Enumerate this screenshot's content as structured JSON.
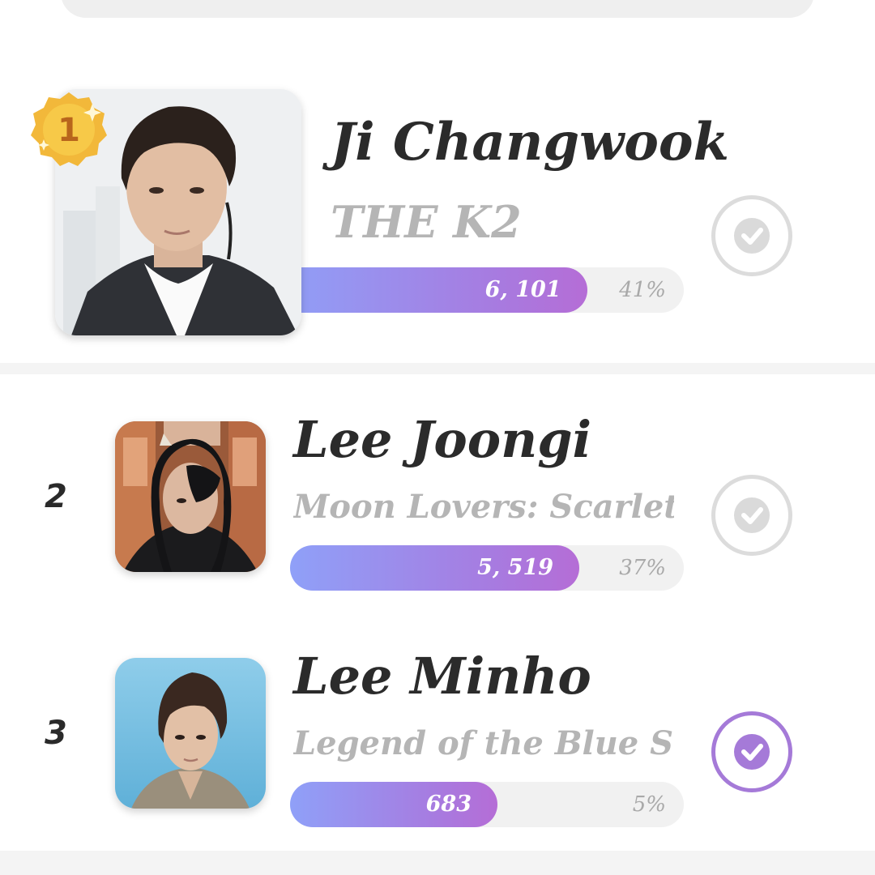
{
  "ranking": [
    {
      "rank": "1",
      "name": "Ji Changwook",
      "show": "THE K2",
      "votes": "6, 101",
      "percent": "41%",
      "share": 0.41,
      "voted": false
    },
    {
      "rank": "2",
      "name": "Lee Joongi",
      "show": "Moon Lovers: Scarlet .",
      "votes": "5, 519",
      "percent": "37%",
      "share": 0.37,
      "voted": false
    },
    {
      "rank": "3",
      "name": "Lee Minho",
      "show": "Legend of the Blue Sea",
      "votes": "683",
      "percent": "5%",
      "share": 0.05,
      "voted": true
    }
  ],
  "colors": {
    "accent_purple": "#a57ad8",
    "bar_start": "#8fa0f8",
    "bar_end": "#b56dd6",
    "medal_gold": "#f5c242"
  },
  "icons": {
    "medal": "gold-medal-icon",
    "vote": "checkmark-circle-icon"
  }
}
